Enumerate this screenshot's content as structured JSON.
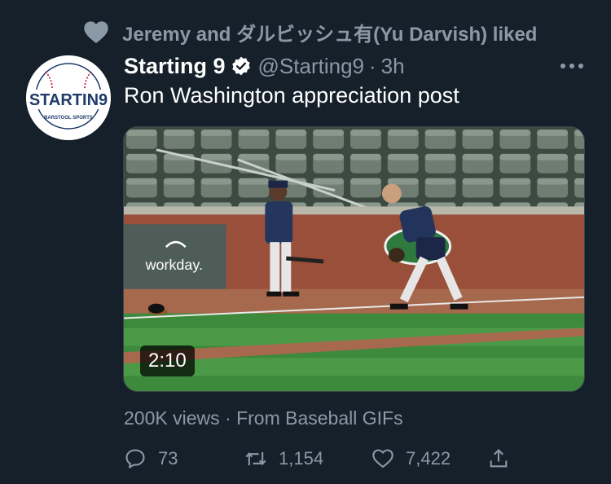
{
  "social_context": {
    "text": "Jeremy and ダルビッシュ有(Yu Darvish) liked",
    "icon": "heart-icon"
  },
  "tweet": {
    "author_name": "Starting 9",
    "handle": "@Starting9",
    "separator": "·",
    "time": "3h",
    "verified": true,
    "text": "Ron Washington appreciation post",
    "avatar": {
      "logo_text": "STARTIN9",
      "logo_subtext": "BARSTOOL SPORTS"
    },
    "media": {
      "type": "video",
      "duration": "2:10",
      "sign_text": "workday."
    },
    "views": "200K views",
    "source_separator": "·",
    "source": "From Baseball GIFs",
    "actions": {
      "replies": "73",
      "retweets": "1,154",
      "likes": "7,422"
    }
  },
  "colors": {
    "background": "#15202b",
    "text_primary": "#ffffff",
    "text_secondary": "#8b98a5",
    "verified": "#ffffff",
    "logo_red": "#c8102e",
    "logo_navy": "#1f3a6b"
  }
}
